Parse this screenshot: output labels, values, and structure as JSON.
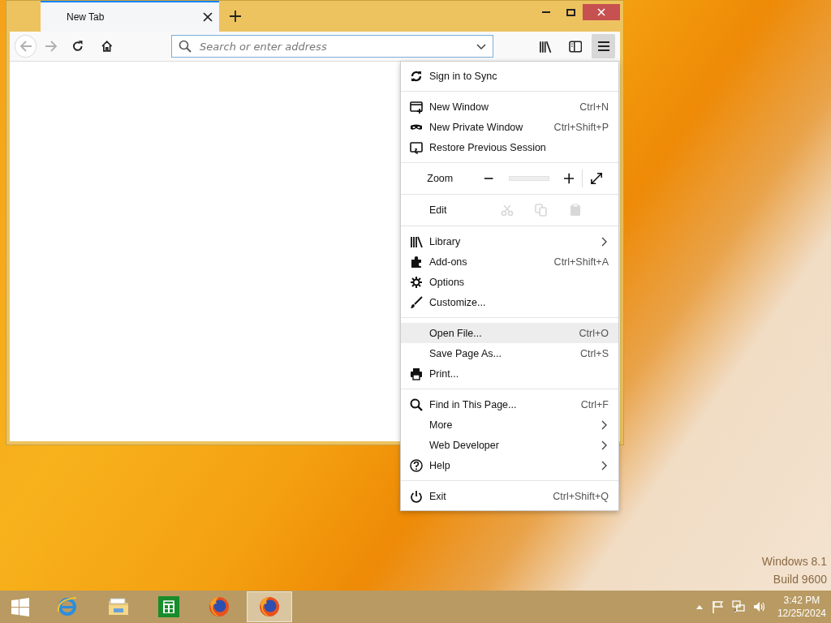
{
  "window": {
    "tabs": [
      {
        "label": "New Tab",
        "selected": true
      }
    ]
  },
  "toolbar": {
    "back_disabled": true,
    "forward_disabled": true,
    "address": {
      "placeholder": "Search or enter address"
    },
    "menu_open": true
  },
  "menu": {
    "sections": [
      [
        {
          "kind": "item",
          "label": "Sign in to Sync",
          "highlighted": false
        }
      ],
      [
        {
          "kind": "item",
          "label": "New Window",
          "shortcut": "Ctrl+N",
          "highlighted": false
        },
        {
          "kind": "item",
          "label": "New Private Window",
          "shortcut": "Ctrl+Shift+P",
          "highlighted": false
        },
        {
          "kind": "item",
          "label": "Restore Previous Session",
          "highlighted": false
        }
      ],
      [
        {
          "kind": "zoom",
          "label": "Zoom"
        }
      ],
      [
        {
          "kind": "edit",
          "label": "Edit",
          "disabled": true
        }
      ],
      [
        {
          "kind": "item",
          "label": "Library",
          "submenu": true,
          "highlighted": false
        },
        {
          "kind": "item",
          "label": "Add-ons",
          "shortcut": "Ctrl+Shift+A",
          "highlighted": false
        },
        {
          "kind": "item",
          "label": "Options",
          "highlighted": false
        },
        {
          "kind": "item",
          "label": "Customize...",
          "highlighted": false
        }
      ],
      [
        {
          "kind": "item",
          "label": "Open File...",
          "shortcut": "Ctrl+O",
          "highlighted": true
        },
        {
          "kind": "item",
          "label": "Save Page As...",
          "shortcut": "Ctrl+S",
          "highlighted": false
        },
        {
          "kind": "item",
          "label": "Print...",
          "highlighted": false
        }
      ],
      [
        {
          "kind": "item",
          "label": "Find in This Page...",
          "shortcut": "Ctrl+F",
          "highlighted": false
        },
        {
          "kind": "item",
          "label": "More",
          "submenu": true,
          "highlighted": false
        },
        {
          "kind": "item",
          "label": "Web Developer",
          "submenu": true,
          "highlighted": false
        },
        {
          "kind": "item",
          "label": "Help",
          "submenu": true,
          "highlighted": false
        }
      ],
      [
        {
          "kind": "item",
          "label": "Exit",
          "shortcut": "Ctrl+Shift+Q",
          "highlighted": false
        }
      ]
    ]
  },
  "desktop": {
    "os_label": "Windows 8.1",
    "build_label": "Build 9600"
  },
  "taskbar": {
    "apps": [
      {
        "selected": false
      },
      {
        "selected": false
      },
      {
        "selected": false
      },
      {
        "selected": false
      },
      {
        "selected": true
      }
    ],
    "clock": {
      "time": "3:42 PM",
      "date": "12/25/2024"
    }
  }
}
